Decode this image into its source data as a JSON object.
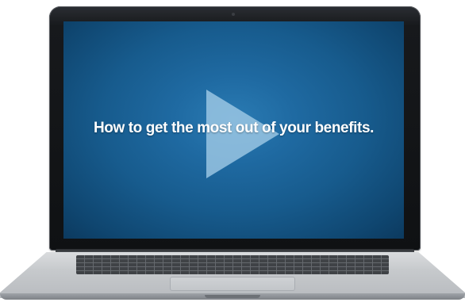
{
  "video": {
    "title": "How to get the most out of your benefits."
  },
  "icons": {
    "play": "play-icon"
  },
  "colors": {
    "screen_background": "#1f6aa2",
    "play_icon": "#a4cde8",
    "title_text": "#ffffff"
  }
}
